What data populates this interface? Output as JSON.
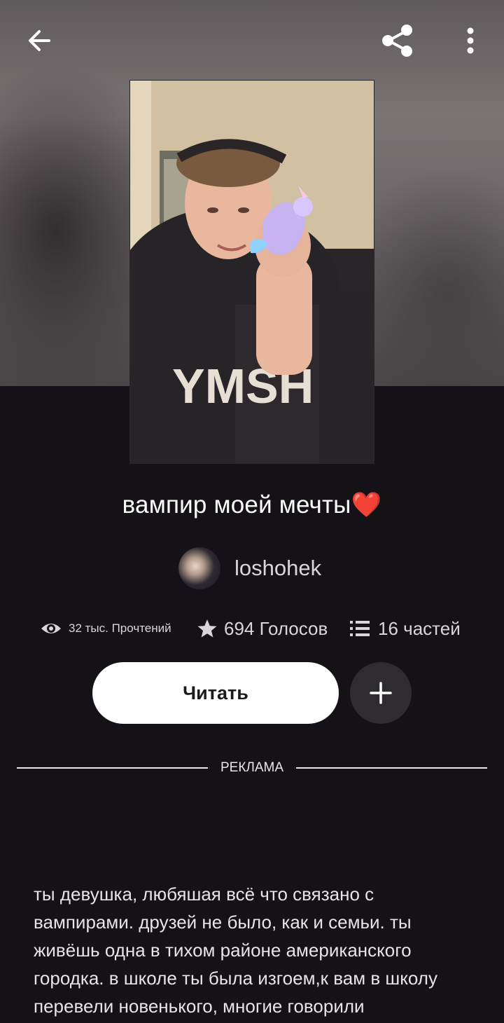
{
  "top_bar": {
    "back_icon": "arrow-left-icon",
    "share_icon": "share-icon",
    "more_icon": "more-vertical-icon"
  },
  "story": {
    "title": "вампир моей мечты",
    "title_emoji": "❤️",
    "author": "loshohek"
  },
  "stats": {
    "reads": "32 тыс. Прочтений",
    "votes": "694 Голосов",
    "parts": "16 частей"
  },
  "actions": {
    "read_label": "Читать",
    "add_icon": "plus-icon"
  },
  "ad": {
    "label": "РЕКЛАМА"
  },
  "description": "ты девушка, любяшая всё что связано с вампирами. друзей не было, как и семьи. ты живёшь одна в тихом районе американского городка. в школе ты была изгоем,к вам в школу перевели новенького, многие говорили",
  "colors": {
    "background": "#141216",
    "heart": "#e0302b",
    "button_bg": "#ffffff",
    "add_button_bg": "#2f2c31"
  }
}
